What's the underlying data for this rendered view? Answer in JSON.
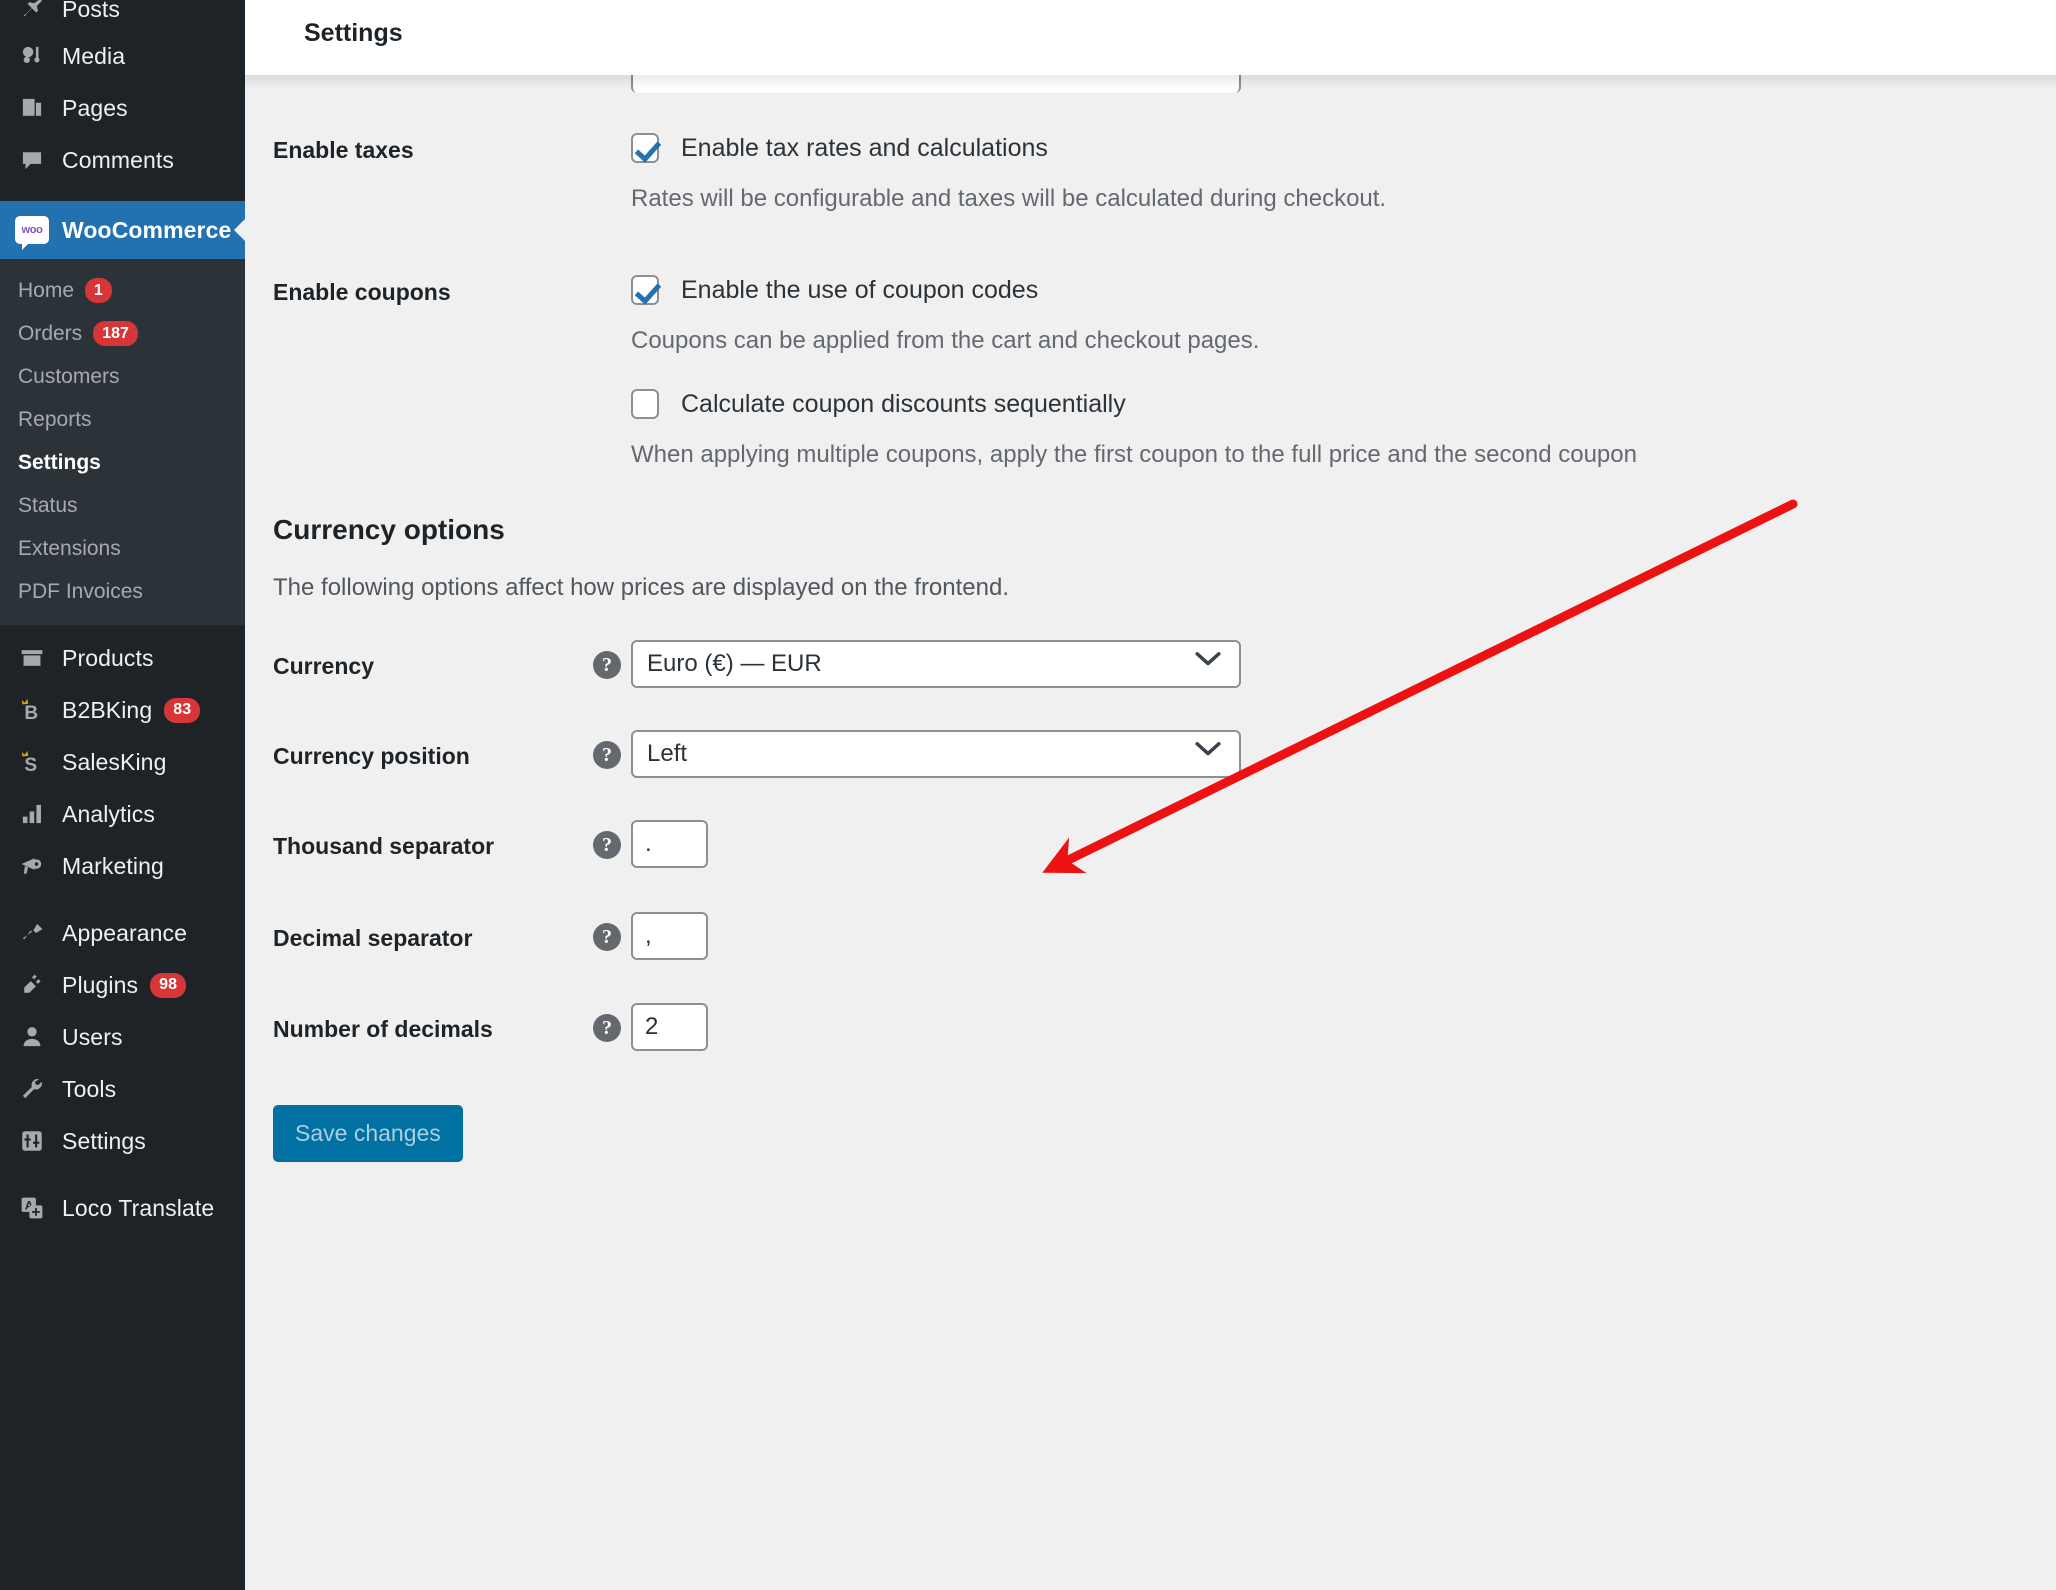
{
  "sidebar": {
    "top_items": [
      {
        "label": "Posts",
        "icon": "pin-icon",
        "badge": null
      },
      {
        "label": "Media",
        "icon": "media-icon",
        "badge": null
      },
      {
        "label": "Pages",
        "icon": "pages-icon",
        "badge": null
      },
      {
        "label": "Comments",
        "icon": "comments-icon",
        "badge": null
      }
    ],
    "active_item": {
      "label": "WooCommerce",
      "icon": "woocommerce-icon"
    },
    "submenu": [
      {
        "label": "Home",
        "badge": "1",
        "current": false
      },
      {
        "label": "Orders",
        "badge": "187",
        "current": false
      },
      {
        "label": "Customers",
        "badge": null,
        "current": false
      },
      {
        "label": "Reports",
        "badge": null,
        "current": false
      },
      {
        "label": "Settings",
        "badge": null,
        "current": true
      },
      {
        "label": "Status",
        "badge": null,
        "current": false
      },
      {
        "label": "Extensions",
        "badge": null,
        "current": false
      },
      {
        "label": "PDF Invoices",
        "badge": null,
        "current": false
      }
    ],
    "bottom_items": [
      {
        "label": "Products",
        "icon": "products-icon",
        "badge": null
      },
      {
        "label": "B2BKing",
        "icon": "b2bking-crown-icon",
        "badge": "83"
      },
      {
        "label": "SalesKing",
        "icon": "salesking-crown-icon",
        "badge": null
      },
      {
        "label": "Analytics",
        "icon": "analytics-bars-icon",
        "badge": null
      },
      {
        "label": "Marketing",
        "icon": "megaphone-icon",
        "badge": null
      },
      {
        "label": "Appearance",
        "icon": "paintbrush-icon",
        "badge": null
      },
      {
        "label": "Plugins",
        "icon": "plug-icon",
        "badge": "98"
      },
      {
        "label": "Users",
        "icon": "user-icon",
        "badge": null
      },
      {
        "label": "Tools",
        "icon": "wrench-icon",
        "badge": null
      },
      {
        "label": "Settings",
        "icon": "sliders-icon",
        "badge": null
      },
      {
        "label": "Loco Translate",
        "icon": "loco-translate-icon",
        "badge": null
      }
    ],
    "colors": {
      "background": "#1d2327",
      "submenu_background": "#2c3338",
      "active_background": "#2271b1",
      "badge_background": "#d63638"
    }
  },
  "header": {
    "title": "Settings"
  },
  "settings": {
    "enable_taxes": {
      "label": "Enable taxes",
      "checkbox_label": "Enable tax rates and calculations",
      "checked": true,
      "helper": "Rates will be configurable and taxes will be calculated during checkout."
    },
    "enable_coupons": {
      "label": "Enable coupons",
      "checkbox_label": "Enable the use of coupon codes",
      "checked": true,
      "helper": "Coupons can be applied from the cart and checkout pages.",
      "sequential_label": "Calculate coupon discounts sequentially",
      "sequential_checked": false,
      "sequential_helper": "When applying multiple coupons, apply the first coupon to the full price and the second coupon"
    },
    "currency_options": {
      "title": "Currency options",
      "description": "The following options affect how prices are displayed on the frontend.",
      "currency": {
        "label": "Currency",
        "value": "Euro (€) — EUR",
        "help": "?"
      },
      "currency_position": {
        "label": "Currency position",
        "value": "Left",
        "help": "?"
      },
      "thousand_separator": {
        "label": "Thousand separator",
        "value": ".",
        "help": "?"
      },
      "decimal_separator": {
        "label": "Decimal separator",
        "value": ",",
        "help": "?"
      },
      "number_of_decimals": {
        "label": "Number of decimals",
        "value": "2",
        "help": "?"
      }
    },
    "save_button": {
      "label": "Save changes",
      "color": "#0071a1"
    }
  },
  "annotation": {
    "arrow_color": "#ee1111",
    "points_to": "currency-select"
  }
}
